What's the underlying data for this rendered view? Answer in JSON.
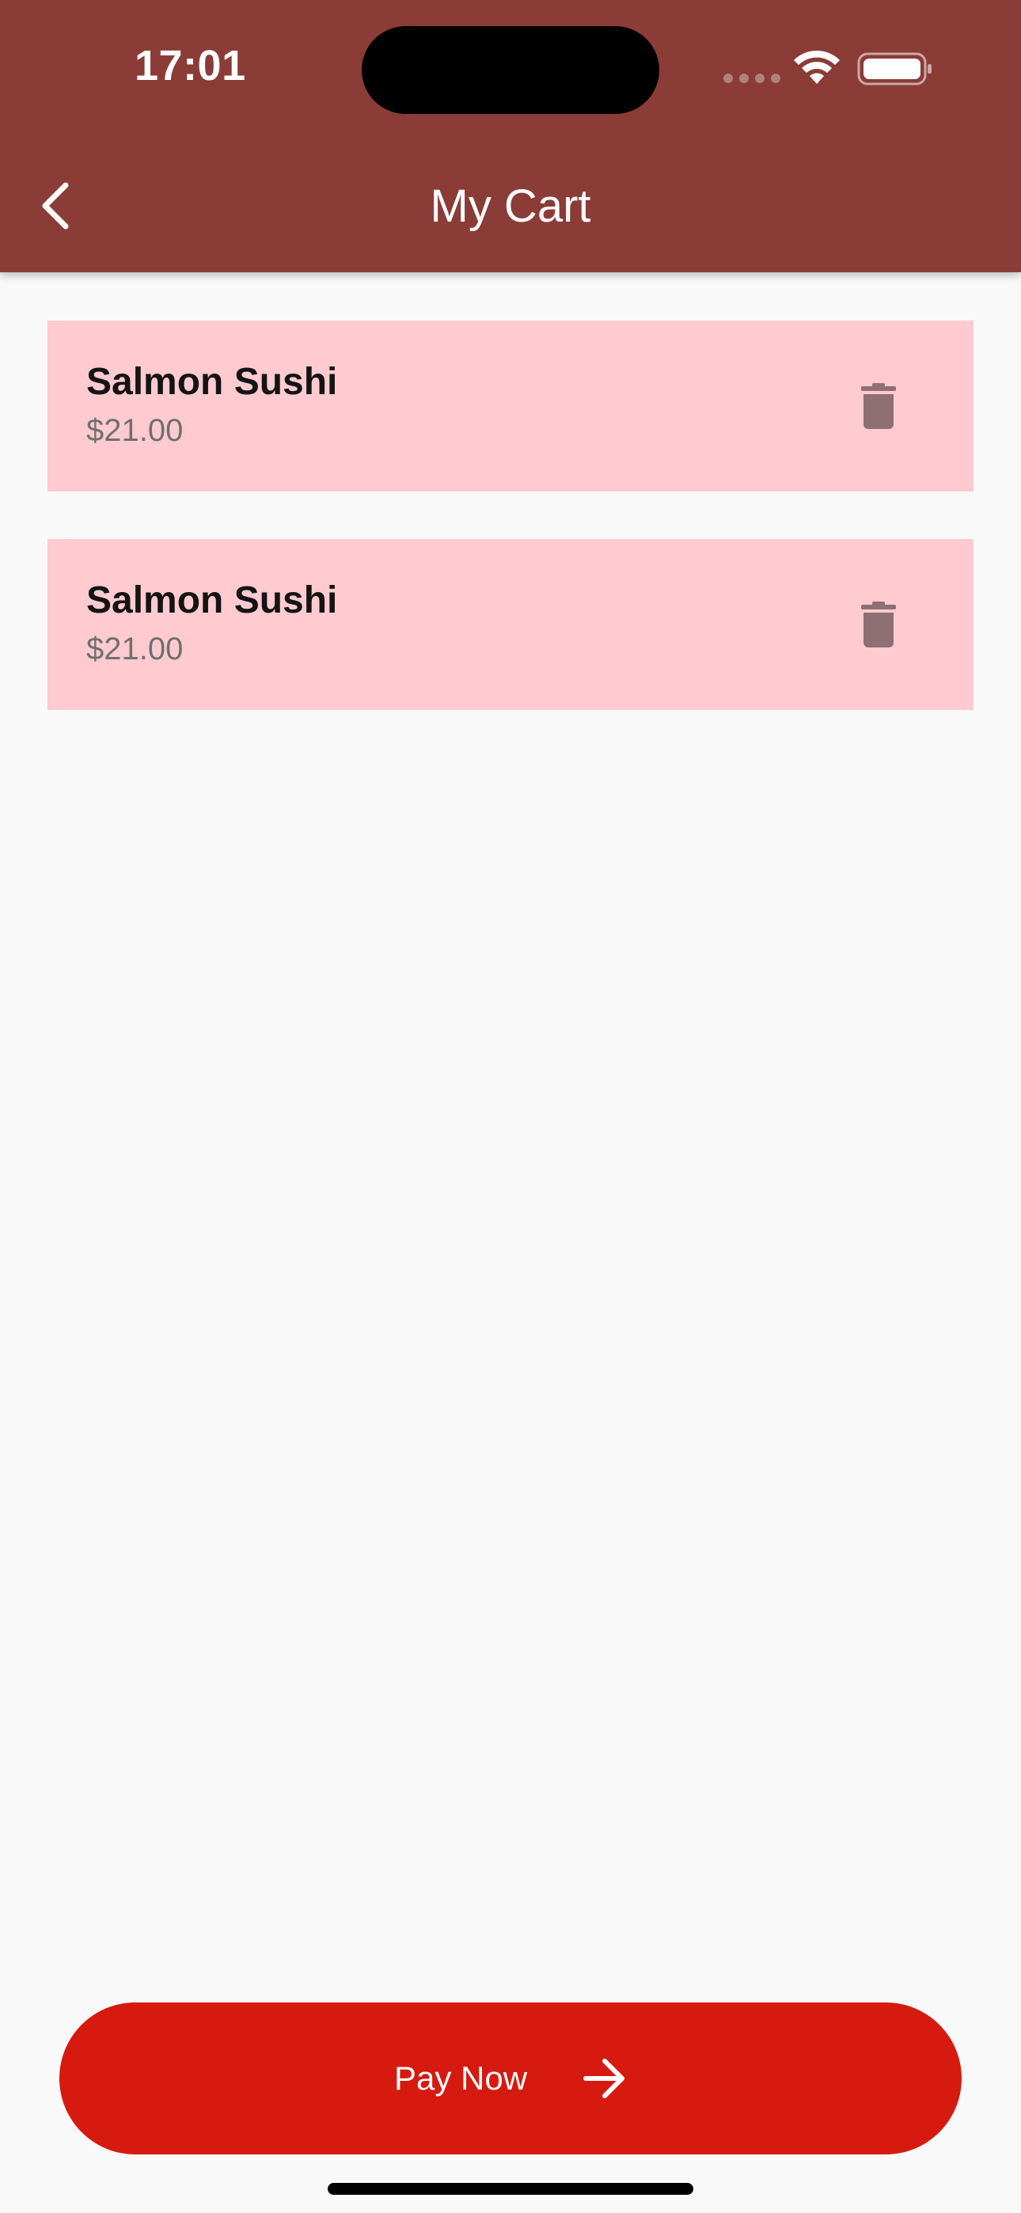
{
  "status_bar": {
    "time": "17:01"
  },
  "header": {
    "title": "My Cart",
    "back_icon": "chevron-left-icon"
  },
  "cart": {
    "items": [
      {
        "name": "Salmon Sushi",
        "price": "$21.00"
      },
      {
        "name": "Salmon Sushi",
        "price": "$21.00"
      }
    ]
  },
  "checkout": {
    "pay_label": "Pay Now",
    "arrow_icon": "arrow-right-icon"
  },
  "colors": {
    "app_bar": "#8b3c37",
    "item_background": "#ffcbd0",
    "pay_button": "#d71a0f",
    "page_background": "#f9f9fa"
  }
}
